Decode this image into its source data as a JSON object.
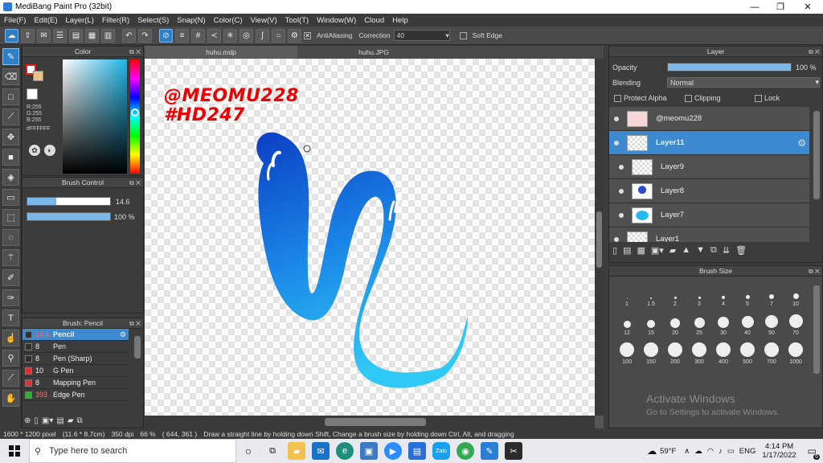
{
  "window": {
    "title": "MediBang Paint Pro (32bit)",
    "minimize": "—",
    "maximize": "❐",
    "close": "✕"
  },
  "menu": [
    "File(F)",
    "Edit(E)",
    "Layer(L)",
    "Filter(R)",
    "Select(S)",
    "Snap(N)",
    "Color(C)",
    "View(V)",
    "Tool(T)",
    "Window(W)",
    "Cloud",
    "Help"
  ],
  "toolbar": {
    "antialias_label": "AntiAliasing",
    "correction_label": "Correction",
    "correction_value": "40",
    "soft_edge_label": "Soft Edge"
  },
  "color_panel": {
    "title": "Color",
    "r": "R:255",
    "g": "G:255",
    "b": "B:255",
    "hex": "#FFFFFF"
  },
  "brush_control": {
    "title": "Brush Control",
    "size": "14.6",
    "opacity": "100 %",
    "size_fraction": 0.35,
    "opacity_fraction": 1.0
  },
  "brush_list": {
    "title": "Brush: Pencil",
    "items": [
      {
        "size": "14.6",
        "name": "Pencil",
        "color": "#2f2f2f",
        "selected": true
      },
      {
        "size": "8",
        "name": "Pen",
        "color": "#2f2f2f"
      },
      {
        "size": "8",
        "name": "Pen (Sharp)",
        "color": "#2f2f2f"
      },
      {
        "size": "10",
        "name": "G Pen",
        "color": "#e03030"
      },
      {
        "size": "8",
        "name": "Mapping Pen",
        "color": "#e03030"
      },
      {
        "size": "393",
        "name": "Edge Pen",
        "color": "#30b030"
      }
    ]
  },
  "tabs": [
    "huhu.mdp",
    "huhu.JPG"
  ],
  "canvas": {
    "watermark_line1": "@MEOMU228",
    "watermark_line2": "#HD247"
  },
  "layer_panel": {
    "title": "Layer",
    "opacity_label": "Opacity",
    "opacity_value": "100 %",
    "blending_label": "Blending",
    "blending_value": "Normal",
    "protect_alpha": "Protect Alpha",
    "clipping": "Clipping",
    "lock": "Lock",
    "layers": [
      {
        "name": "@meomu228"
      },
      {
        "name": "Layer11",
        "selected": true
      },
      {
        "name": "Layer9"
      },
      {
        "name": "Layer8"
      },
      {
        "name": "Layer7"
      },
      {
        "name": "Layer1"
      }
    ]
  },
  "brush_size_panel": {
    "title": "Brush Size",
    "sizes": [
      "1",
      "1.5",
      "2",
      "3",
      "4",
      "5",
      "7",
      "10",
      "12",
      "15",
      "20",
      "25",
      "30",
      "40",
      "50",
      "70",
      "100",
      "150",
      "200",
      "300",
      "400",
      "500",
      "700",
      "1000"
    ]
  },
  "activate": {
    "line1": "Activate Windows",
    "line2": "Go to Settings to activate Windows."
  },
  "status": {
    "pixels": "1600 * 1200 pixel",
    "cm": "(11.6 * 8.7cm)",
    "dpi": "350 dpi",
    "zoom": "66 %",
    "coords": "( 644, 361 )",
    "hint": "Draw a straight line by holding down Shift, Change a brush size by holding down Ctrl, Alt, and dragging"
  },
  "taskbar": {
    "search_placeholder": "Type here to search",
    "temp": "59°F",
    "lang": "ENG",
    "time": "4:14 PM",
    "date": "1/17/2022",
    "notif_count": "6"
  }
}
